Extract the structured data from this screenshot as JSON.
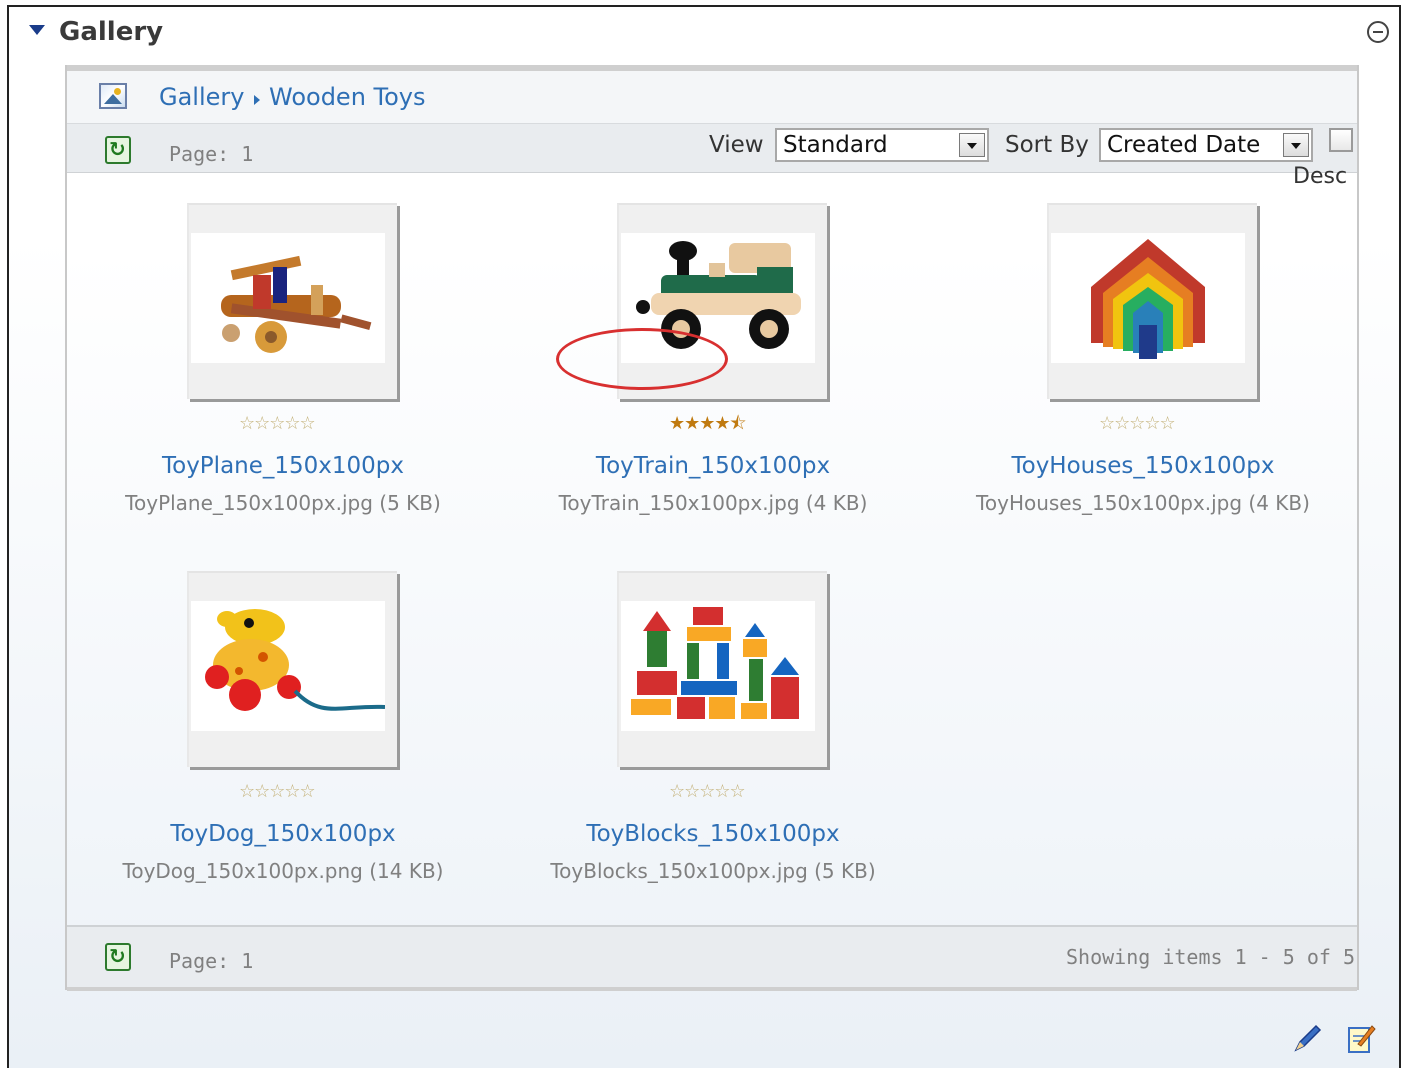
{
  "module": {
    "title": "Gallery"
  },
  "breadcrumb": {
    "root": "Gallery",
    "current": "Wooden Toys"
  },
  "toolbar": {
    "page_label": "Page: 1",
    "view_label": "View",
    "view_value": "Standard",
    "sort_label": "Sort By",
    "sort_value": "Created Date",
    "desc_label": "Desc",
    "desc_checked": false
  },
  "items": [
    {
      "title": "ToyPlane_150x100px",
      "file": "ToyPlane_150x100px.jpg (5 KB)",
      "rating": 0,
      "max_rating": 5
    },
    {
      "title": "ToyTrain_150x100px",
      "file": "ToyTrain_150x100px.jpg (4 KB)",
      "rating": 4.5,
      "max_rating": 5,
      "highlighted": true
    },
    {
      "title": "ToyHouses_150x100px",
      "file": "ToyHouses_150x100px.jpg (4 KB)",
      "rating": 0,
      "max_rating": 5
    },
    {
      "title": "ToyDog_150x100px",
      "file": "ToyDog_150x100px.png (14 KB)",
      "rating": 0,
      "max_rating": 5
    },
    {
      "title": "ToyBlocks_150x100px",
      "file": "ToyBlocks_150x100px.jpg (5 KB)",
      "rating": 0,
      "max_rating": 5
    }
  ],
  "footer": {
    "page_label": "Page: 1",
    "showing": "Showing items 1 - 5 of 5"
  },
  "icons": {
    "collapse": "triangle-down-icon",
    "minimize": "minimize-icon",
    "gallery": "gallery-image-icon",
    "refresh": "refresh-icon",
    "pencil": "pencil-icon",
    "edit": "edit-note-icon"
  },
  "colors": {
    "link": "#2e6fb5",
    "star_rated": "#c07a10",
    "highlight_circle": "#d83030"
  }
}
